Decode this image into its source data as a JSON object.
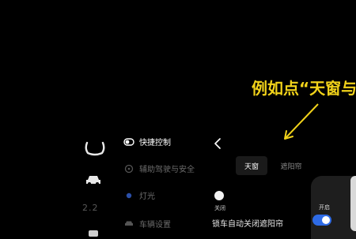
{
  "annotation": {
    "text": "例如点“天窗与"
  },
  "left_rail": {
    "number": "2.2"
  },
  "menu": {
    "items": [
      {
        "label": "快捷控制",
        "icon": "toggle-icon"
      },
      {
        "label": "辅助驾驶与安全",
        "icon": "steering-wheel-icon"
      },
      {
        "label": "灯光",
        "icon": "light-dot-icon"
      },
      {
        "label": "车辆设置",
        "icon": "car-icon"
      }
    ]
  },
  "detail": {
    "tabs": [
      {
        "label": "天窗",
        "active": true
      },
      {
        "label": "遮阳帘",
        "active": false
      }
    ],
    "close_label": "关闭",
    "lock_label": "锁车自动关闭遮阳帘",
    "open_label": "开启",
    "toggle_on": true
  },
  "colors": {
    "background": "#000000",
    "annotation": "#f1d21a",
    "toggle_on": "#2e6be6"
  }
}
